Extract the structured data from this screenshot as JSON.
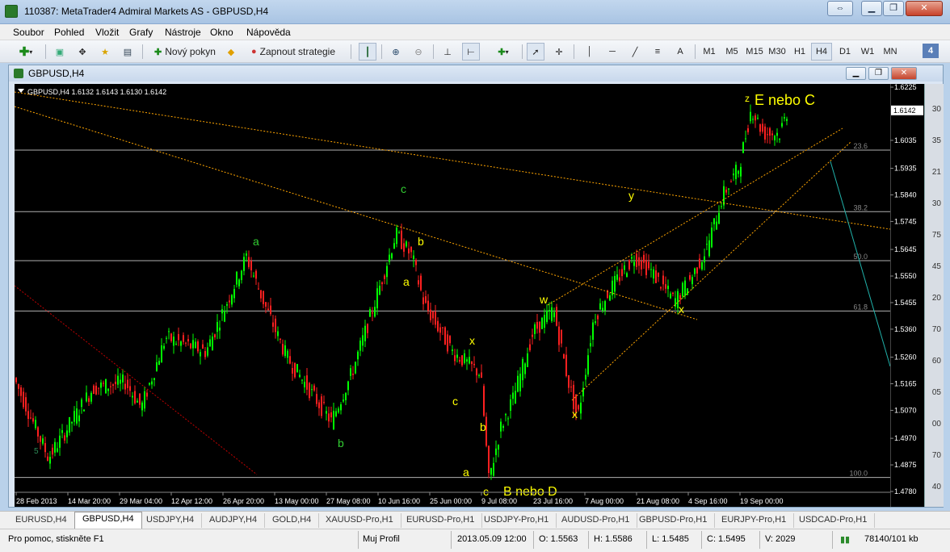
{
  "window": {
    "title": "110387: MetaTrader4 Admiral Markets AS - GBPUSD,H4"
  },
  "menu": [
    "Soubor",
    "Pohled",
    "Vložit",
    "Grafy",
    "Nástroje",
    "Okno",
    "Nápověda"
  ],
  "toolbar": {
    "new_order": "Nový pokyn",
    "autotrading": "Zapnout strategie",
    "text_tool": "A",
    "timeframes": [
      "M1",
      "M5",
      "M15",
      "M30",
      "H1",
      "H4",
      "D1",
      "W1",
      "MN"
    ],
    "active_timeframe": "H4",
    "ctrl_number": "4"
  },
  "chart_window": {
    "title": "GBPUSD,H4"
  },
  "chart_data": {
    "type": "line",
    "symbol_info": "GBPUSD,H4  1.6132 1.6143 1.6130 1.6142",
    "price_axis": [
      "1.6225",
      "1.6035",
      "1.5935",
      "1.5840",
      "1.5745",
      "1.5645",
      "1.5550",
      "1.5455",
      "1.5360",
      "1.5260",
      "1.5165",
      "1.5070",
      "1.4970",
      "1.4875",
      "1.4780"
    ],
    "current_price": "1.6142",
    "ylim": [
      1.478,
      1.6225
    ],
    "time_axis": [
      "28 Feb 2013",
      "14 Mar 20:00",
      "29 Mar 04:00",
      "12 Apr 12:00",
      "26 Apr 20:00",
      "13 May 00:00",
      "27 May 08:00",
      "10 Jun 16:00",
      "25 Jun 00:00",
      "9 Jul 08:00",
      "23 Jul 16:00",
      "7 Aug 00:00",
      "21 Aug 08:00",
      "4 Sep 16:00",
      "19 Sep 00:00"
    ],
    "fibo_levels": [
      {
        "label": "23.6",
        "price": 1.6
      },
      {
        "label": "38.2",
        "price": 1.578
      },
      {
        "label": "50.0",
        "price": 1.5605
      },
      {
        "label": "61.8",
        "price": 1.5425
      },
      {
        "label": "100.0",
        "price": 1.483
      }
    ],
    "wave_labels": [
      {
        "text": "5",
        "color": "#2e8b57"
      },
      {
        "text": "a",
        "color": "#32cd32"
      },
      {
        "text": "b",
        "color": "#32cd32"
      },
      {
        "text": "c",
        "color": "#32cd32"
      },
      {
        "text": "b",
        "color": "#ffff00"
      },
      {
        "text": "a",
        "color": "#ffff00"
      },
      {
        "text": "x",
        "color": "#ffff00"
      },
      {
        "text": "c",
        "color": "#ffff00"
      },
      {
        "text": "b",
        "color": "#ffff00"
      },
      {
        "text": "a",
        "color": "#ffff00"
      },
      {
        "text": "c",
        "color": "#ffff00"
      },
      {
        "text": "B nebo D",
        "color": "#ffff00"
      },
      {
        "text": "w",
        "color": "#ffff00"
      },
      {
        "text": "x",
        "color": "#ffff00"
      },
      {
        "text": "y",
        "color": "#ffff00"
      },
      {
        "text": "x",
        "color": "#ffff00"
      },
      {
        "text": "z",
        "color": "#ffff00"
      },
      {
        "text": "E nebo C",
        "color": "#ffff00"
      }
    ],
    "right_panel_fragments": [
      "30",
      "35",
      "21",
      "30",
      "75",
      "45",
      "20",
      "70",
      "60",
      "05",
      "00",
      "70",
      "40"
    ],
    "colors": {
      "background": "#000000",
      "bull": "#00ff00",
      "bear": "#ff2020",
      "grid": "#b0b0b0",
      "trend": "#ffa500"
    }
  },
  "tabs": [
    "EURUSD,H4",
    "GBPUSD,H4",
    "USDJPY,H4",
    "AUDJPY,H4",
    "GOLD,H4",
    "XAUUSD-Pro,H1",
    "EURUSD-Pro,H1",
    "USDJPY-Pro,H1",
    "AUDUSD-Pro,H1",
    "GBPUSD-Pro,H1",
    "EURJPY-Pro,H1",
    "USDCAD-Pro,H1"
  ],
  "active_tab": "GBPUSD,H4",
  "status": {
    "help": "Pro pomoc, stiskněte F1",
    "profile": "Muj Profil",
    "datetime": "2013.05.09 12:00",
    "open": "O: 1.5563",
    "high": "H: 1.5586",
    "low": "L: 1.5485",
    "close": "C: 1.5495",
    "volume": "V: 2029",
    "traffic": "78140/101 kb"
  }
}
